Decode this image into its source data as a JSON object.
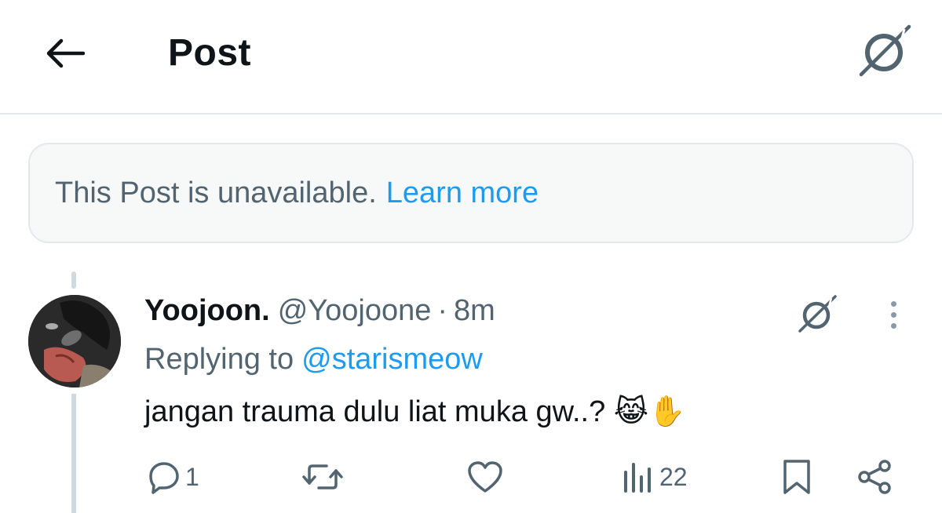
{
  "header": {
    "title": "Post",
    "back_icon": "arrow-left-icon",
    "grok_icon": "grok-icon"
  },
  "notice": {
    "text": "This Post is unavailable.",
    "link": "Learn more"
  },
  "reply": {
    "author_name": "Yoojoon.",
    "author_handle": "@Yoojoone",
    "separator": "·",
    "timestamp": "8m",
    "replying_prefix": "Replying to",
    "replying_handle": "@starismeow",
    "text": "jangan trauma dulu liat muka gw..? 😹✋"
  },
  "actions": {
    "reply_count": "1",
    "repost_count": "",
    "like_count": "",
    "views_count": "22"
  },
  "colors": {
    "text_primary": "#0f1419",
    "text_secondary": "#536471",
    "link_blue": "#1d9bf0",
    "border": "#e5e8eb",
    "notice_bg": "#f7f9f9"
  }
}
